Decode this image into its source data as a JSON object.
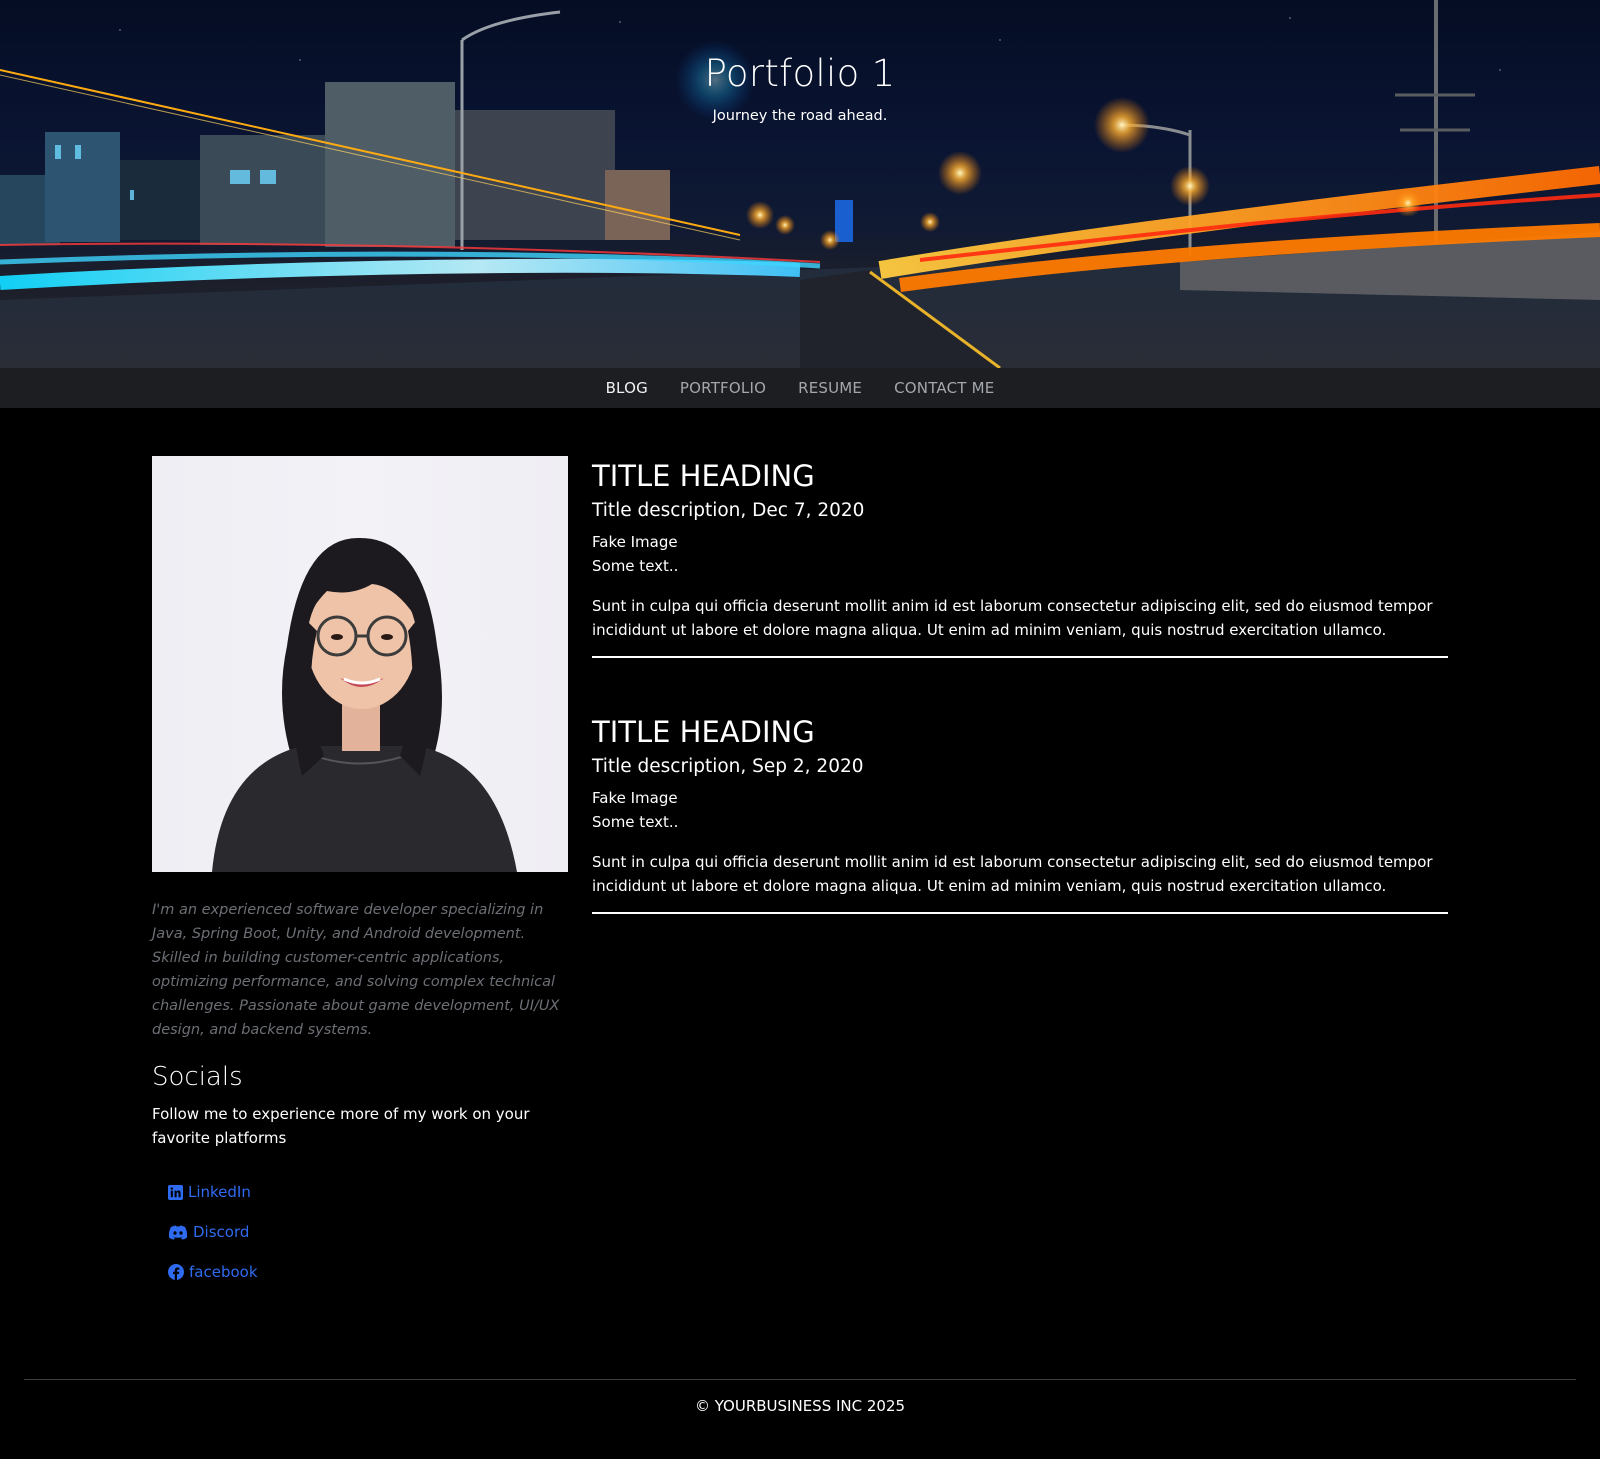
{
  "hero": {
    "title": "Portfolio 1",
    "subtitle": "Journey the road ahead."
  },
  "nav": {
    "items": [
      {
        "label": "BLOG",
        "active": true
      },
      {
        "label": "PORTFOLIO",
        "active": false
      },
      {
        "label": "RESUME",
        "active": false
      },
      {
        "label": "CONTACT ME",
        "active": false
      }
    ]
  },
  "sidebar": {
    "bio": "I'm an experienced software developer specializing in Java, Spring Boot, Unity, and Android development. Skilled in building customer-centric applications, optimizing performance, and solving complex technical challenges. Passionate about game development, UI/UX design, and backend systems.",
    "socials_title": "Socials",
    "socials_text": "Follow me to experience more of my work on your favorite platforms",
    "links": [
      {
        "label": "LinkedIn",
        "icon": "linkedin-icon"
      },
      {
        "label": "Discord",
        "icon": "discord-icon"
      },
      {
        "label": "facebook",
        "icon": "facebook-icon"
      }
    ]
  },
  "posts": [
    {
      "heading": "TITLE HEADING",
      "description": "Title description, Dec 7, 2020",
      "fake_image": "Fake Image",
      "some_text": "Some text..",
      "body": "Sunt in culpa qui officia deserunt mollit anim id est laborum consectetur adipiscing elit, sed do eiusmod tempor incididunt ut labore et dolore magna aliqua. Ut enim ad minim veniam, quis nostrud exercitation ullamco."
    },
    {
      "heading": "TITLE HEADING",
      "description": "Title description, Sep 2, 2020",
      "fake_image": "Fake Image",
      "some_text": "Some text..",
      "body": "Sunt in culpa qui officia deserunt mollit anim id est laborum consectetur adipiscing elit, sed do eiusmod tempor incididunt ut labore et dolore magna aliqua. Ut enim ad minim veniam, quis nostrud exercitation ullamco."
    }
  ],
  "footer": {
    "copyright": "© YOURBUSINESS INC 2025"
  },
  "colors": {
    "background": "#000000",
    "nav_background": "#1c1e22",
    "link_blue": "#2f6bf0",
    "muted_text": "#6c6f75"
  }
}
